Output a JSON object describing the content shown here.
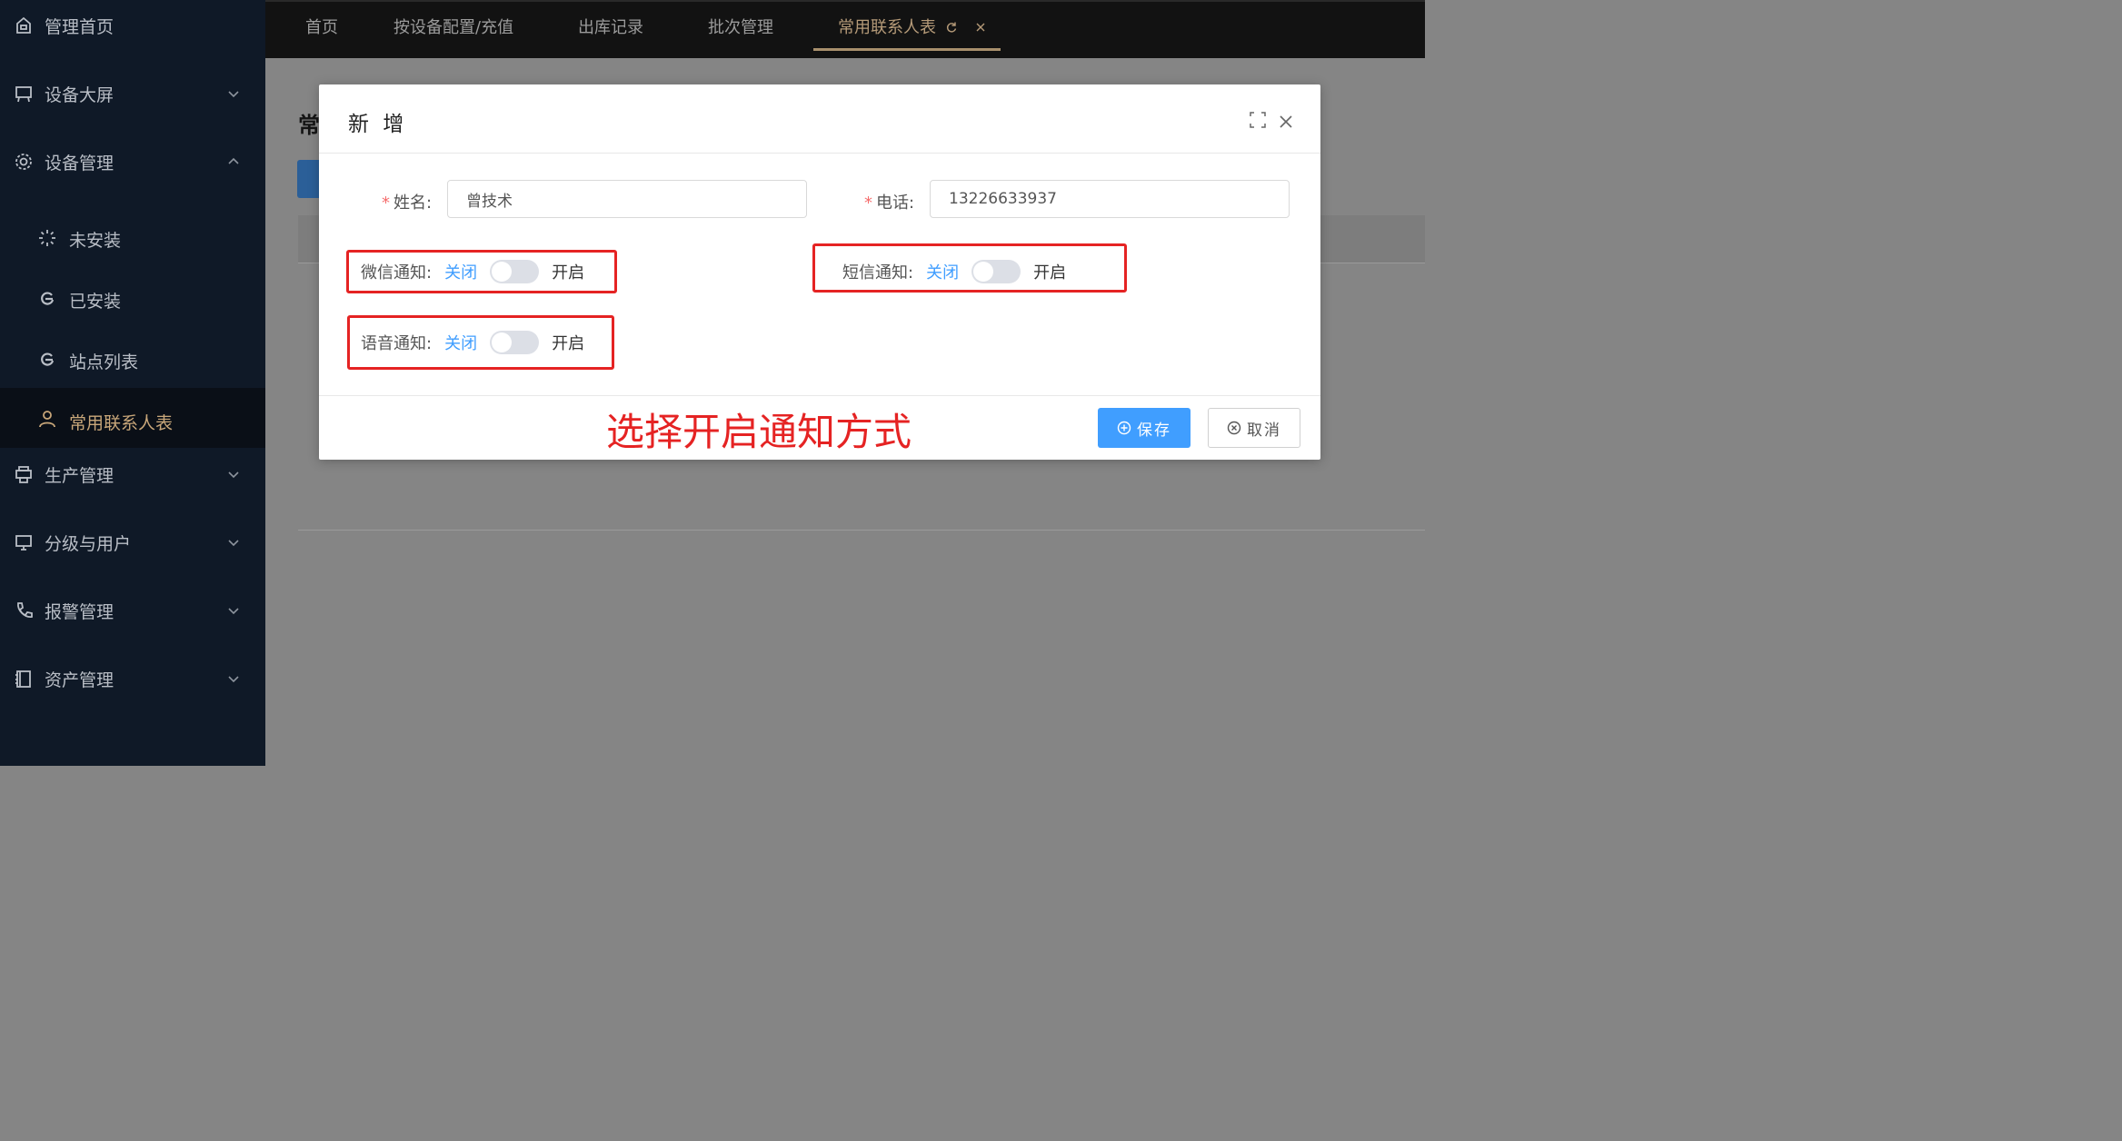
{
  "sidebar": {
    "items": [
      {
        "label": "管理首页",
        "icon": "home-icon"
      },
      {
        "label": "设备大屏",
        "icon": "presentation-icon",
        "expanded": false
      },
      {
        "label": "设备管理",
        "icon": "gear-icon",
        "expanded": true
      },
      {
        "label": "生产管理",
        "icon": "printer-icon",
        "expanded": false
      },
      {
        "label": "分级与用户",
        "icon": "monitor-icon",
        "expanded": false
      },
      {
        "label": "报警管理",
        "icon": "phone-icon",
        "expanded": false
      },
      {
        "label": "资产管理",
        "icon": "notebook-icon",
        "expanded": false
      }
    ],
    "sub_items": [
      {
        "label": "未安装",
        "icon": "loading-icon"
      },
      {
        "label": "已安装",
        "icon": "refresh-icon"
      },
      {
        "label": "站点列表",
        "icon": "refresh-icon"
      },
      {
        "label": "常用联系人表",
        "icon": "user-icon",
        "active": true
      }
    ]
  },
  "tabs": [
    {
      "label": "首页"
    },
    {
      "label": "按设备配置/充值"
    },
    {
      "label": "出库记录"
    },
    {
      "label": "批次管理"
    },
    {
      "label": "常用联系人表",
      "active": true
    }
  ],
  "background": {
    "title_partial": "常"
  },
  "dialog": {
    "title": "新 增",
    "name_label": "姓名:",
    "name_value": "曾技术",
    "phone_label": "电话:",
    "phone_value": "13226633937",
    "wechat": {
      "label": "微信通知:",
      "off": "关闭",
      "on": "开启",
      "checked": false
    },
    "sms": {
      "label": "短信通知:",
      "off": "关闭",
      "on": "开启",
      "checked": false
    },
    "voice": {
      "label": "语音通知:",
      "off": "关闭",
      "on": "开启",
      "checked": false
    },
    "save_label": "保存",
    "cancel_label": "取消"
  },
  "annotation": "选择开启通知方式",
  "colors": {
    "primary": "#409eff",
    "annotation_red": "#e52323",
    "sidebar_bg": "#0f1927",
    "active_gold": "#c9a77a"
  }
}
